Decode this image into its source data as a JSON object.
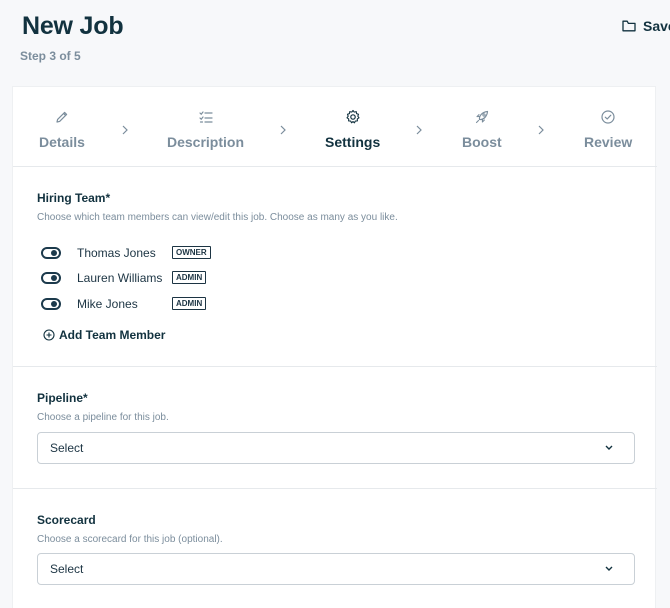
{
  "header": {
    "title": "New Job",
    "step_indicator": "Step 3 of 5",
    "save_label": "Save"
  },
  "stepper": {
    "steps": [
      {
        "label": "Details",
        "icon": "pencil-icon",
        "active": false
      },
      {
        "label": "Description",
        "icon": "checklist-icon",
        "active": false
      },
      {
        "label": "Settings",
        "icon": "gear-icon",
        "active": true
      },
      {
        "label": "Boost",
        "icon": "rocket-icon",
        "active": false
      },
      {
        "label": "Review",
        "icon": "check-circle-icon",
        "active": false
      }
    ]
  },
  "hiring_team": {
    "title": "Hiring Team*",
    "description": "Choose which team members can view/edit this job. Choose as many as you like.",
    "members": [
      {
        "name": "Thomas Jones",
        "role": "OWNER",
        "enabled": true
      },
      {
        "name": "Lauren Williams",
        "role": "ADMIN",
        "enabled": true
      },
      {
        "name": "Mike Jones",
        "role": "ADMIN",
        "enabled": true
      }
    ],
    "add_label": "Add Team Member"
  },
  "pipeline": {
    "title": "Pipeline*",
    "description": "Choose a pipeline for this job.",
    "selected": "Select"
  },
  "scorecard": {
    "title": "Scorecard",
    "description": "Choose a scorecard for this job (optional).",
    "selected": "Select"
  },
  "colors": {
    "primary_text": "#12323f",
    "muted_text": "#7b8d9c",
    "background": "#f7f8fa",
    "card": "#ffffff"
  }
}
